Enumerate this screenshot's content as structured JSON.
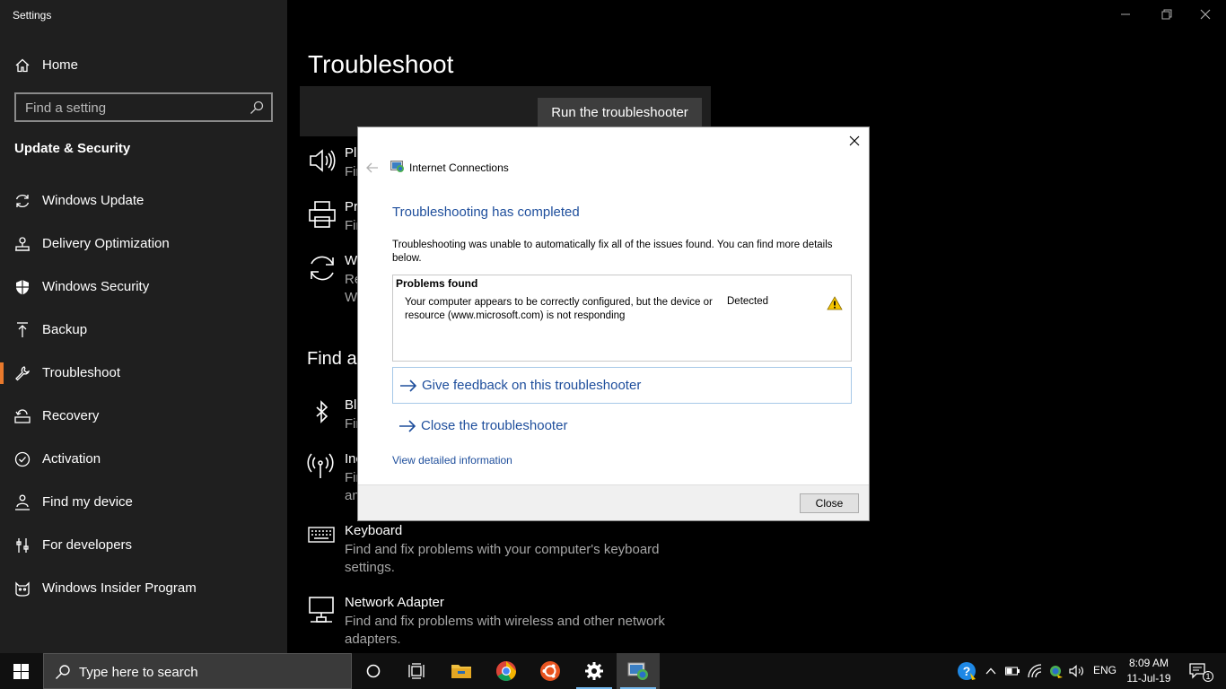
{
  "window": {
    "app_title": "Settings",
    "minimize_icon": "minimize-icon",
    "restore_icon": "restore-icon",
    "close_icon": "close-icon"
  },
  "sidebar": {
    "home_label": "Home",
    "search_placeholder": "Find a setting",
    "section_title": "Update & Security",
    "items": [
      {
        "label": "Windows Update",
        "icon": "refresh-icon"
      },
      {
        "label": "Delivery Optimization",
        "icon": "delivery-icon"
      },
      {
        "label": "Windows Security",
        "icon": "shield-icon"
      },
      {
        "label": "Backup",
        "icon": "backup-arrow-icon"
      },
      {
        "label": "Troubleshoot",
        "icon": "wrench-icon",
        "selected": true
      },
      {
        "label": "Recovery",
        "icon": "recovery-icon"
      },
      {
        "label": "Activation",
        "icon": "check-circle-icon"
      },
      {
        "label": "Find my device",
        "icon": "person-pin-icon"
      },
      {
        "label": "For developers",
        "icon": "developer-icon"
      },
      {
        "label": "Windows Insider Program",
        "icon": "insider-cat-icon"
      }
    ],
    "accent_color": "#e8792c"
  },
  "main": {
    "page_title": "Troubleshoot",
    "run_button_label": "Run the troubleshooter",
    "top_items": [
      {
        "name": "Pla",
        "desc": "Fin",
        "icon": "speaker-icon"
      },
      {
        "name": "Pri",
        "desc": "Fin",
        "icon": "printer-icon"
      },
      {
        "name": "Wi",
        "desc": "Re\nWi",
        "icon": "sync-icon"
      }
    ],
    "find_heading": "Find a",
    "lower_items": [
      {
        "name": "Blu",
        "desc": "Fin",
        "icon": "bluetooth-icon"
      },
      {
        "name": "Inc",
        "desc": "Fir\nan",
        "icon": "antenna-icon"
      },
      {
        "name": "Keyboard",
        "desc": "Find and fix problems with your computer's keyboard settings.",
        "icon": "keyboard-icon"
      },
      {
        "name": "Network Adapter",
        "desc": "Find and fix problems with wireless and other network adapters.",
        "icon": "network-adapter-icon"
      }
    ]
  },
  "dialog": {
    "app_name": "Internet Connections",
    "heading": "Troubleshooting has completed",
    "message": "Troubleshooting was unable to automatically fix all of the issues found. You can find more details below.",
    "problems_title": "Problems found",
    "problem_text": "Your computer appears to be correctly configured, but the device or resource (www.microsoft.com) is not responding",
    "problem_status": "Detected",
    "feedback_link": "Give feedback on this troubleshooter",
    "close_link": "Close the troubleshooter",
    "detail_link": "View detailed information",
    "close_button": "Close",
    "link_color": "#1e4e9c"
  },
  "taskbar": {
    "search_placeholder": "Type here to search",
    "apps": [
      "cortana-circle-icon",
      "task-view-icon",
      "file-explorer-icon",
      "chrome-icon",
      "ubuntu-icon",
      "settings-gear-icon",
      "troubleshooter-icon"
    ],
    "language": "ENG",
    "time": "8:09 AM",
    "date": "11-Jul-19",
    "notification_count": "1"
  }
}
